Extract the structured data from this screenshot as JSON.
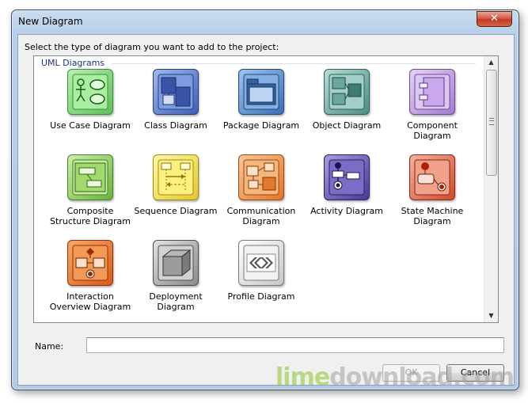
{
  "window": {
    "title": "New Diagram",
    "close_glyph": "✕"
  },
  "prompt": "Select the type of diagram you want to add to the project:",
  "group": {
    "title": "UML Diagrams"
  },
  "diagrams": [
    {
      "label": "Use Case Diagram",
      "icon": "use-case-icon",
      "color": "#6fc86a"
    },
    {
      "label": "Class Diagram",
      "icon": "class-icon",
      "color": "#4b6fc2"
    },
    {
      "label": "Package Diagram",
      "icon": "package-icon",
      "color": "#4a7dc0"
    },
    {
      "label": "Object Diagram",
      "icon": "object-icon",
      "color": "#5f9a94"
    },
    {
      "label": "Component Diagram",
      "icon": "component-icon",
      "color": "#b58fd9"
    },
    {
      "label": "Composite Structure Diagram",
      "icon": "composite-structure-icon",
      "color": "#7fbf4e"
    },
    {
      "label": "Sequence Diagram",
      "icon": "sequence-icon",
      "color": "#e6d43a"
    },
    {
      "label": "Communication Diagram",
      "icon": "communication-icon",
      "color": "#ea8b3a"
    },
    {
      "label": "Activity Diagram",
      "icon": "activity-icon",
      "color": "#5a45a8"
    },
    {
      "label": "State Machine Diagram",
      "icon": "state-machine-icon",
      "color": "#d8553c"
    },
    {
      "label": "Interaction Overview Diagram",
      "icon": "interaction-overview-icon",
      "color": "#e26a28"
    },
    {
      "label": "Deployment Diagram",
      "icon": "deployment-icon",
      "color": "#8d8d8d"
    },
    {
      "label": "Profile Diagram",
      "icon": "profile-icon",
      "color": "#d0d0d0"
    }
  ],
  "name_label": "Name:",
  "name_value": "",
  "buttons": {
    "ok": "OK",
    "cancel": "Cancel"
  },
  "watermark": {
    "part1": "lime",
    "part2": "download.com"
  }
}
